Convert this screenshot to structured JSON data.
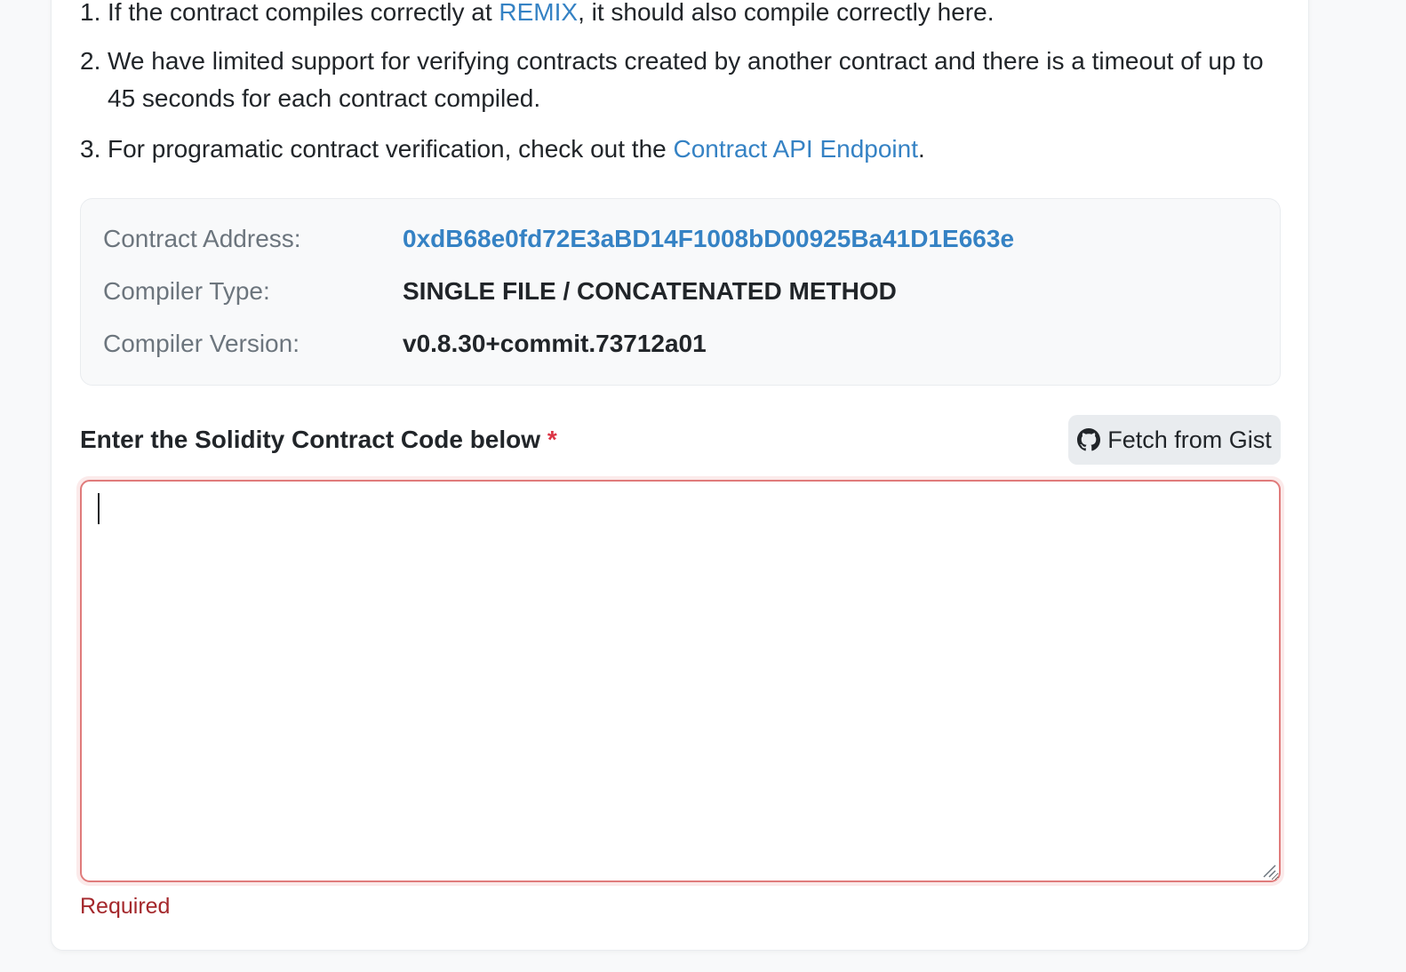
{
  "instructions": {
    "item1": {
      "num": "1.",
      "before": "If the contract compiles correctly at ",
      "link": "REMIX",
      "after": ", it should also compile correctly here."
    },
    "item2": {
      "num": "2.",
      "text": "We have limited support for verifying contracts created by another contract and there is a timeout of up to 45 seconds for each contract compiled."
    },
    "item3": {
      "num": "3.",
      "before": "For programatic contract verification, check out the ",
      "link": "Contract API Endpoint",
      "after": "."
    }
  },
  "contract_info": {
    "address_label": "Contract Address:",
    "address_value": "0xdB68e0fd72E3aBD14F1008bD00925Ba41D1E663e",
    "compiler_type_label": "Compiler Type:",
    "compiler_type_value": "SINGLE FILE / CONCATENATED METHOD",
    "compiler_version_label": "Compiler Version:",
    "compiler_version_value": "v0.8.30+commit.73712a01"
  },
  "code_section": {
    "label": "Enter the Solidity Contract Code below",
    "required_marker": "*",
    "fetch_button": "Fetch from Gist",
    "fetch_button_icon": "github-icon",
    "code_value": "",
    "error_text": "Required"
  },
  "colors": {
    "link": "#3582c4",
    "error": "#a4282c",
    "required": "#dc3545",
    "error_border": "#e07b7b"
  }
}
